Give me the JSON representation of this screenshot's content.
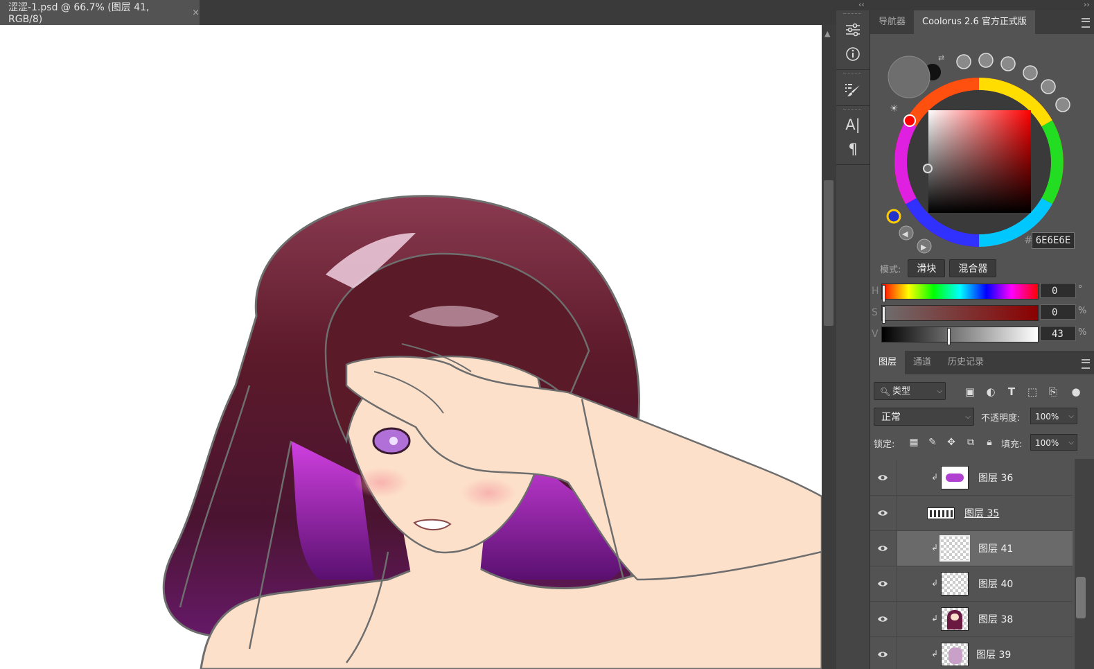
{
  "document": {
    "tab_title": "涩涩-1.psd @ 66.7% (图层 41, RGB/8)",
    "tab_close": "×"
  },
  "colors": {
    "canvas_bg": "#ffffff",
    "skin": "#fde0ca",
    "hair_dark": "#5a1a28",
    "hair_highlight": "#f0d0e0",
    "hair_purple": "#c038d8",
    "outline": "#6e6e6e"
  },
  "icon_strip": {
    "collapse_glyph": "‹‹",
    "expand_glyph": "››",
    "icons": [
      "adjust-sliders-icon",
      "info-icon",
      "brush-presets-icon",
      "character-icon",
      "paragraph-icon"
    ]
  },
  "color_panel": {
    "tabs": [
      "导航器",
      "Coolorus 2.6 官方正式版"
    ],
    "active_tab": 1,
    "hex_hash": "#",
    "hex_value": "6E6E6E",
    "mode_label": "模式:",
    "mode_buttons": [
      "滑块",
      "混合器"
    ],
    "sliders": [
      {
        "letter": "H",
        "value": "0",
        "unit": "°",
        "position": 0.0
      },
      {
        "letter": "S",
        "value": "0",
        "unit": "%",
        "position": 0.0
      },
      {
        "letter": "V",
        "value": "43",
        "unit": "%",
        "position": 0.43
      }
    ],
    "current_color": "#6e6e6e"
  },
  "layers_panel": {
    "tabs": [
      "图层",
      "通道",
      "历史记录"
    ],
    "active_tab": 0,
    "filter_label": "类型",
    "blend_mode": "正常",
    "opacity_label": "不透明度:",
    "opacity_value": "100%",
    "lock_label": "锁定:",
    "fill_label": "填充:",
    "fill_value": "100%",
    "layers": [
      {
        "name": "图层 36",
        "clipped": true,
        "selected": false
      },
      {
        "name": "图层 35",
        "clipped": false,
        "selected": false
      },
      {
        "name": "图层 41",
        "clipped": true,
        "selected": true
      },
      {
        "name": "图层 40",
        "clipped": true,
        "selected": false
      },
      {
        "name": "图层 38",
        "clipped": true,
        "selected": false
      },
      {
        "name": "图层 39",
        "clipped": true,
        "selected": false
      }
    ]
  }
}
